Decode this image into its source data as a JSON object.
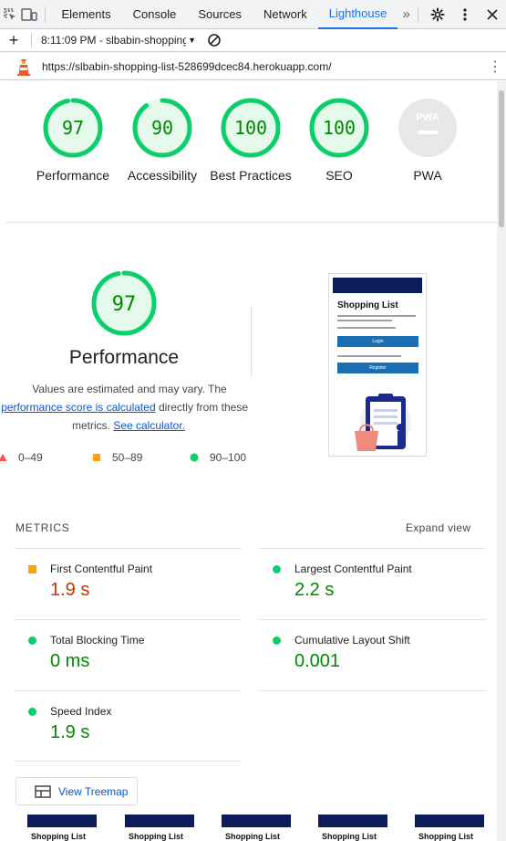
{
  "devtools": {
    "tabs": [
      "Elements",
      "Console",
      "Sources",
      "Network",
      "Lighthouse"
    ],
    "active_tab": "Lighthouse",
    "more_tabs": "»"
  },
  "toolbar": {
    "add_label": "+",
    "report_label": "8:11:09 PM - slbabin-shopping",
    "dropdown_arrow": "▼"
  },
  "url_bar": {
    "url": "https://slbabin-shopping-list-528699dcec84.herokuapp.com/",
    "menu": "⋮"
  },
  "gauges": [
    {
      "score": "97",
      "label": "Performance"
    },
    {
      "score": "90",
      "label": "Accessibility"
    },
    {
      "score": "100",
      "label": "Best Practices"
    },
    {
      "score": "100",
      "label": "SEO"
    },
    {
      "score": "PWA",
      "label": "PWA"
    }
  ],
  "performance": {
    "score": "97",
    "title": "Performance",
    "desc_1": "Values are estimated and may vary. The",
    "desc_link_1": "performance score is calculated",
    "desc_2": " directly from these",
    "desc_3": "metrics. ",
    "desc_link_2": "See calculator.",
    "legend": [
      {
        "range": "0–49",
        "color": "#ff4e42"
      },
      {
        "range": "50–89",
        "color": "#ffa400"
      },
      {
        "range": "90–100",
        "color": "#0cce6b"
      }
    ]
  },
  "screenshot": {
    "title": "Shopping List",
    "login_btn": "Login",
    "register_btn": "Register"
  },
  "metrics": {
    "header": "METRICS",
    "expand": "Expand view",
    "items": [
      {
        "title": "First Contentful Paint",
        "value": "1.9 s",
        "rating": "average"
      },
      {
        "title": "Largest Contentful Paint",
        "value": "2.2 s",
        "rating": "pass"
      },
      {
        "title": "Total Blocking Time",
        "value": "0 ms",
        "rating": "pass"
      },
      {
        "title": "Cumulative Layout Shift",
        "value": "0.001",
        "rating": "pass"
      },
      {
        "title": "Speed Index",
        "value": "1.9 s",
        "rating": "pass"
      }
    ]
  },
  "treemap": {
    "label": "View Treemap"
  },
  "filmstrip": {
    "title": "Shopping List"
  },
  "colors": {
    "pass": "#0cce6b",
    "average": "#ffa400",
    "fail": "#ff4e42",
    "accent": "#1a73e8",
    "link": "#0b57d0"
  },
  "icons": [
    "inspect-element-icon",
    "device-toolbar-icon",
    "gear-icon",
    "kebab-menu-icon",
    "clear-icon",
    "lighthouse-logo-icon",
    "treemap-icon"
  ]
}
